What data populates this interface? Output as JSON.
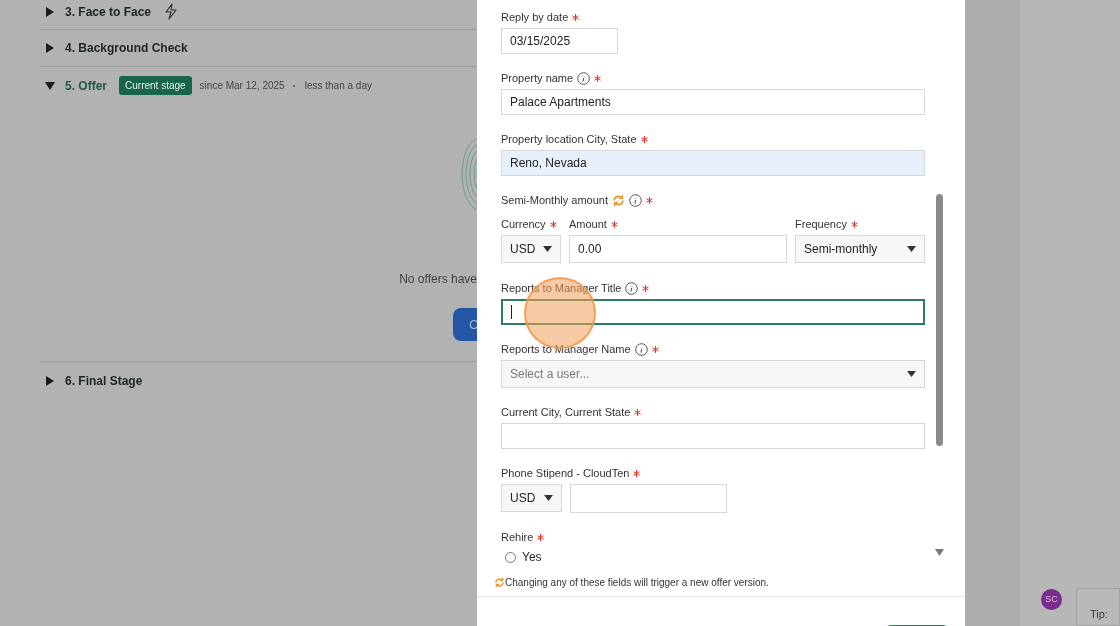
{
  "stages": [
    {
      "label": "3. Face to Face",
      "expanded": false,
      "current": false,
      "trigger": true
    },
    {
      "label": "4. Background Check",
      "expanded": false,
      "current": false,
      "trigger": false
    },
    {
      "label": "5. Offer",
      "expanded": true,
      "current": true,
      "trigger": false,
      "badge": "Current stage",
      "since": "since Mar 12, 2025",
      "duration": "less than a day",
      "empty_text": "No offers have",
      "button": "C"
    },
    {
      "label": "6. Final Stage",
      "expanded": false,
      "current": false,
      "trigger": false
    }
  ],
  "offer_form": {
    "fields": [
      {
        "kind": "date",
        "label": "Reply by date",
        "required": true,
        "info": false,
        "value": "03/15/2025"
      },
      {
        "kind": "text",
        "label": "Property name",
        "required": true,
        "info": true,
        "value": "Palace Apartments"
      },
      {
        "kind": "text",
        "label": "Property location City, State",
        "required": true,
        "info": false,
        "autofilled": true,
        "value": "Reno, Nevada"
      },
      {
        "kind": "group",
        "label": "Semi-Monthly amount",
        "required": true,
        "info": true,
        "versioned": true,
        "parts": [
          {
            "kind": "select",
            "label": "Currency",
            "required": true,
            "value": "USD"
          },
          {
            "kind": "text",
            "label": "Amount",
            "required": true,
            "value": "0.00"
          },
          {
            "kind": "select",
            "label": "Frequency",
            "required": true,
            "value": "Semi-monthly"
          }
        ]
      },
      {
        "kind": "text",
        "label": "Reports to Manager Title",
        "required": true,
        "info": true,
        "focused": true
      },
      {
        "kind": "select",
        "label": "Reports to Manager Name",
        "required": true,
        "info": true,
        "placeholder": "Select a user..."
      },
      {
        "kind": "text",
        "label": "Current City, Current State",
        "required": true,
        "info": false
      },
      {
        "kind": "currency",
        "label": "Phone Stipend - CloudTen",
        "required": true,
        "info": false,
        "currency": "USD"
      },
      {
        "kind": "radio",
        "label": "Rehire",
        "required": true,
        "info": false,
        "options": [
          {
            "label": "Yes",
            "selected": false
          }
        ]
      }
    ],
    "note": "Changing any of these fields will trigger a new offer version."
  },
  "avatar": {
    "initials": "SC",
    "color": "#7b2a8e"
  },
  "tip": "Tip:"
}
